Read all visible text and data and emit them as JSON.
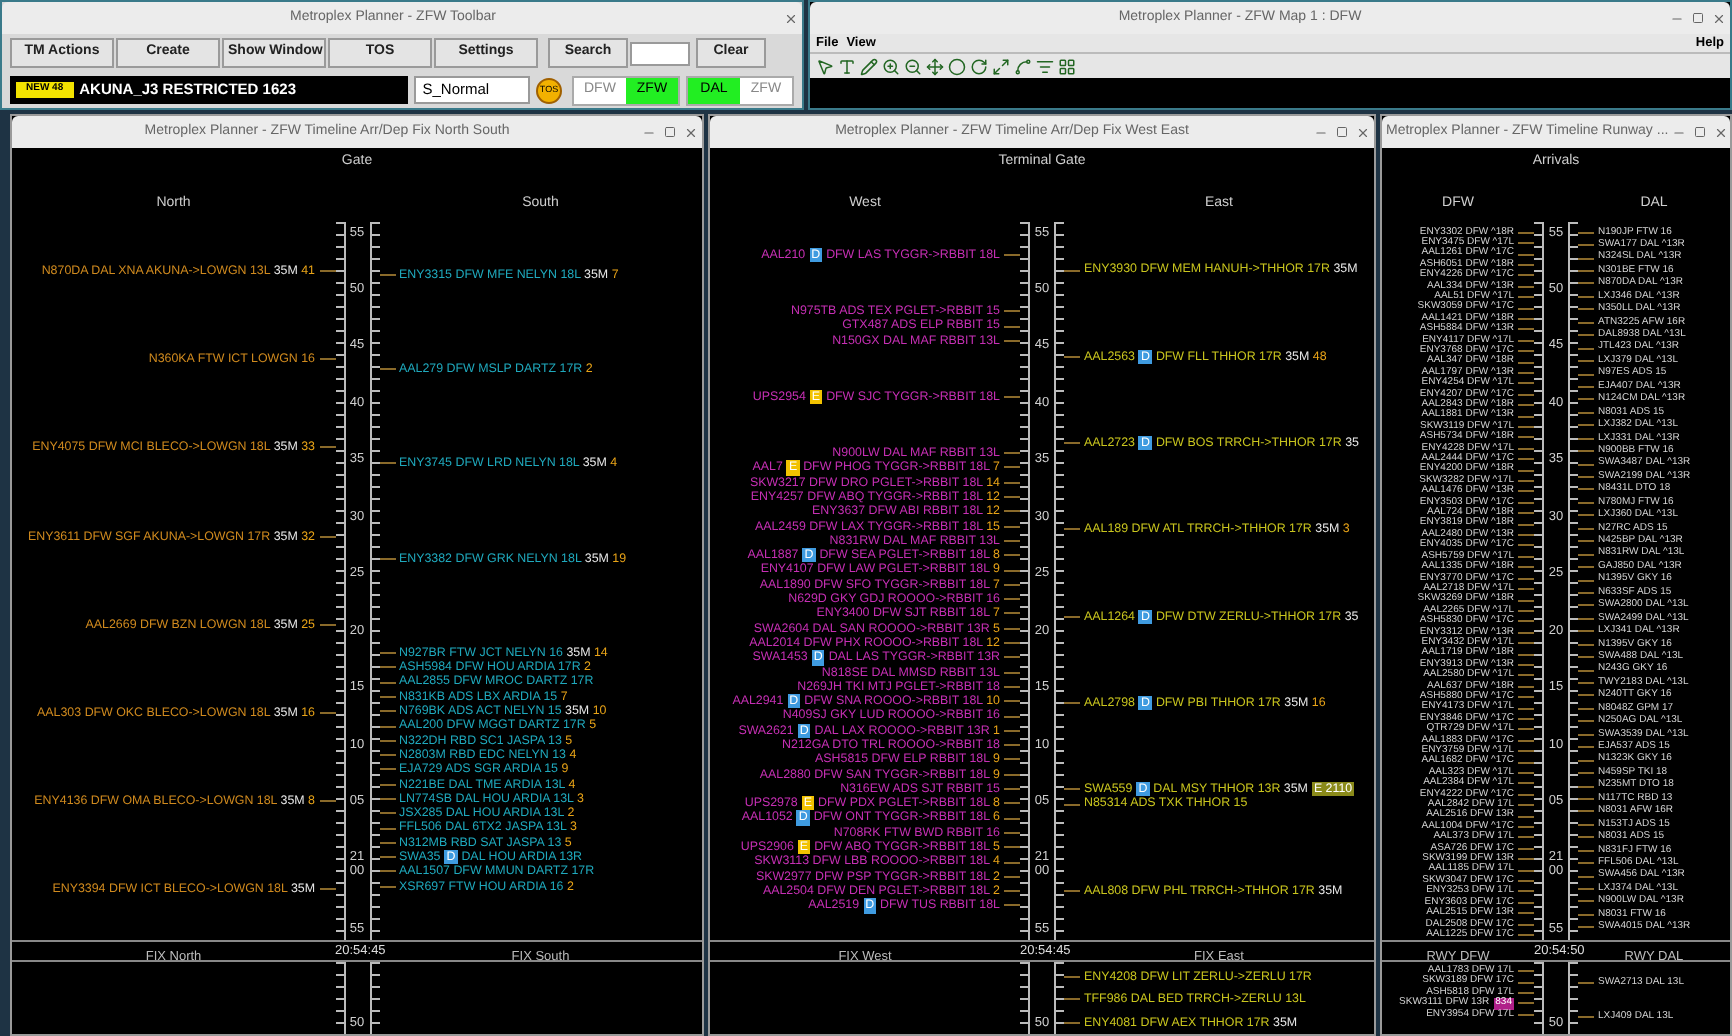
{
  "toolbar": {
    "title": "Metroplex Planner - ZFW Toolbar",
    "buttons": [
      "TM Actions",
      "Create",
      "Show Window",
      "TOS",
      "Settings"
    ],
    "search_button": "Search",
    "clear_button": "Clear",
    "alert_badge": "NEW 48",
    "message": "AKUNA_J3 RESTRICTED 1623",
    "mode_field": "S_Normal",
    "tos_indicator": "TOS",
    "toggles": [
      {
        "label": "DFW",
        "selected": false
      },
      {
        "label": "ZFW",
        "selected": true
      },
      {
        "label": "DAL",
        "selected": true
      },
      {
        "label": "ZFW",
        "selected": false
      }
    ]
  },
  "map_window": {
    "title": "Metroplex Planner - ZFW Map 1 : DFW",
    "menu": [
      "File",
      "View"
    ],
    "help_menu": "Help"
  },
  "timelines": [
    {
      "kind": "fix",
      "title": "Metroplex Planner - ZFW Timeline Arr/Dep Fix North South",
      "heading": "Gate",
      "scale_labels": [
        "55",
        "50",
        "45",
        "40",
        "35",
        "30",
        "25",
        "20",
        "15",
        "10",
        "05",
        "21 00",
        "55"
      ],
      "footer_time": "20:54:45",
      "lower_scale_label": "50",
      "columns": [
        {
          "heading": "North",
          "footer": "FIX North",
          "color": "#d08a1e",
          "groups": [
            [
              {
                "callsign": "N870DA",
                "route": "DAL XNA AKUNA->LOWGN 13L",
                "size": "35M",
                "count": "41"
              }
            ],
            [
              {
                "callsign": "N360KA",
                "route": "FTW ICT LOWGN 16"
              }
            ],
            [
              {
                "callsign": "ENY4075",
                "route": "DFW MCI BLECO->LOWGN 18L",
                "size": "35M",
                "count": "33"
              }
            ],
            [
              {
                "callsign": "ENY3611",
                "route": "DFW SGF AKUNA->LOWGN 17R",
                "size": "35M",
                "count": "32"
              }
            ],
            [
              {
                "callsign": "AAL2669",
                "route": "DFW BZN LOWGN 18L",
                "size": "35M",
                "count": "25"
              }
            ],
            [
              {
                "callsign": "AAL303",
                "route": "DFW OKC BLECO->LOWGN 18L",
                "size": "35M",
                "count": "16"
              }
            ],
            [
              {
                "callsign": "ENY4136",
                "route": "DFW OMA BLECO->LOWGN 18L",
                "size": "35M",
                "count": "8"
              }
            ],
            [
              {
                "callsign": "ENY3394",
                "route": "DFW ICT BLECO->LOWGN 18L",
                "size": "35M"
              }
            ]
          ]
        },
        {
          "heading": "South",
          "footer": "FIX South",
          "color": "#1fa9bd",
          "groups": [
            [
              {
                "callsign": "ENY3315",
                "route": "DFW MFE NELYN 18L",
                "size": "35M",
                "count": "7"
              }
            ],
            [
              {
                "callsign": "AAL279",
                "route": "DFW MSLP DARTZ 17R",
                "count": "2"
              }
            ],
            [
              {
                "callsign": "ENY3745",
                "route": "DFW LRD NELYN 18L",
                "size": "35M",
                "count": "4"
              }
            ],
            [
              {
                "callsign": "ENY3382",
                "route": "DFW GRK NELYN 18L",
                "size": "35M",
                "count": "19"
              }
            ],
            [
              {
                "callsign": "N927BR",
                "route": "FTW JCT NELYN 16",
                "size": "35M",
                "count": "14"
              },
              {
                "callsign": "ASH5984",
                "route": "DFW HOU ARDIA 17R",
                "count": "2"
              },
              {
                "callsign": "AAL2855",
                "route": "DFW MROC DARTZ 17R"
              },
              {
                "callsign": "N831KB",
                "route": "ADS LBX ARDIA 15",
                "count": "7"
              },
              {
                "callsign": "N769BK",
                "route": "ADS ACT NELYN 15",
                "size": "35M",
                "count": "10"
              },
              {
                "callsign": "AAL200",
                "route": "DFW MGGT DARTZ 17R",
                "count": "5"
              },
              {
                "callsign": "N322DH",
                "route": "RBD SC1 JASPA 13",
                "count": "5"
              },
              {
                "callsign": "N2803M",
                "route": "RBD EDC NELYN 13",
                "count": "4"
              },
              {
                "callsign": "EJA729",
                "route": "ADS SGR ARDIA 15",
                "count": "9"
              },
              {
                "callsign": "N221BE",
                "route": "DAL TME ARDIA 13L",
                "count": "4"
              },
              {
                "callsign": "LN774SB",
                "route": "DAL HOU ARDIA 13L",
                "count": "3"
              },
              {
                "callsign": "JSX285",
                "route": "DAL HOU ARDIA 13L",
                "count": "2"
              },
              {
                "callsign": "FFL506",
                "route": "DAL 6TX2 JASPA 13L",
                "count": "3"
              },
              {
                "callsign": "N312MB",
                "route": "RBD SAT JASPA 13",
                "count": "5"
              },
              {
                "callsign": "SWA35",
                "badge": {
                  "label": "D",
                  "color": "#3f9be0"
                },
                "route": "DAL HOU ARDIA 13R"
              },
              {
                "callsign": "AAL1507",
                "route": "DFW MMUN DARTZ 17R"
              },
              {
                "callsign": "XSR697",
                "route": "FTW HOU ARDIA 16",
                "count": "2"
              }
            ]
          ]
        }
      ]
    },
    {
      "kind": "fix",
      "title": "Metroplex Planner - ZFW Timeline Arr/Dep Fix West East",
      "heading": "Terminal Gate",
      "scale_labels": [
        "55",
        "50",
        "45",
        "40",
        "35",
        "30",
        "25",
        "20",
        "15",
        "10",
        "05",
        "21 00",
        "55"
      ],
      "footer_time": "20:54:45",
      "lower_scale_label": "50",
      "columns": [
        {
          "heading": "West",
          "footer": "FIX West",
          "color": "#c62fb4",
          "groups": [
            [
              {
                "callsign": "AAL210",
                "badge": {
                  "label": "D",
                  "color": "#3f9be0"
                },
                "route": "DFW LAS TYGGR->RBBIT 18L"
              }
            ],
            [
              {
                "callsign": "N975TB",
                "route": "ADS TEX PGLET->RBBIT 15"
              },
              {
                "callsign": "GTX487",
                "route": "ADS ELP RBBIT 15"
              },
              {
                "callsign": "N150GX",
                "route": "DAL MAF RBBIT 13L"
              }
            ],
            [
              {
                "callsign": "UPS2954",
                "badge": {
                  "label": "E",
                  "color": "#f2c200"
                },
                "route": "DFW SJC TYGGR->RBBIT 18L"
              }
            ],
            [
              {
                "callsign": "N900LW",
                "route": "DAL MAF RBBIT 13L"
              },
              {
                "callsign": "AAL7",
                "badge": {
                  "label": "E",
                  "color": "#f2c200"
                },
                "route": "DFW PHOG TYGGR->RBBIT 18L",
                "count": "7"
              },
              {
                "callsign": "SKW3217",
                "route": "DFW DRO PGLET->RBBIT 18L",
                "count": "14"
              },
              {
                "callsign": "ENY4257",
                "route": "DFW ABQ TYGGR->RBBIT 18L",
                "count": "12"
              },
              {
                "callsign": "ENY3637",
                "route": "DFW ABI RBBIT 18L",
                "count": "12"
              },
              {
                "callsign": "AAL2459",
                "route": "DFW LAX TYGGR->RBBIT 18L",
                "count": "15"
              },
              {
                "callsign": "N831RW",
                "route": "DAL MAF RBBIT 13L"
              },
              {
                "callsign": "AAL1887",
                "badge": {
                  "label": "D",
                  "color": "#3f9be0"
                },
                "route": "DFW SEA PGLET->RBBIT 18L",
                "count": "8"
              },
              {
                "callsign": "ENY4107",
                "route": "DFW LAW PGLET->RBBIT 18L",
                "count": "9"
              },
              {
                "callsign": "AAL1890",
                "route": "DFW SFO TYGGR->RBBIT 18L",
                "count": "7"
              },
              {
                "callsign": "N629D",
                "route": "GKY GDJ ROOOO->RBBIT 16"
              },
              {
                "callsign": "ENY3400",
                "route": "DFW SJT RBBIT 18L",
                "count": "7"
              },
              {
                "callsign": "SWA2604",
                "route": "DAL SAN ROOOO->RBBIT 13R",
                "count": "5"
              },
              {
                "callsign": "AAL2014",
                "route": "DFW PHX ROOOO->RBBIT 18L",
                "count": "12"
              },
              {
                "callsign": "SWA1453",
                "badge": {
                  "label": "D",
                  "color": "#3f9be0"
                },
                "route": "DAL LAS TYGGR->RBBIT 13R"
              },
              {
                "callsign": "N818SE",
                "route": "DAL MMSD RBBIT 13L"
              },
              {
                "callsign": "N269JH",
                "route": "TKI MTJ PGLET->RBBIT 18"
              },
              {
                "callsign": "AAL2941",
                "badge": {
                  "label": "D",
                  "color": "#3f9be0"
                },
                "route": "DFW SNA ROOOO->RBBIT 18L",
                "count": "10"
              },
              {
                "callsign": "N409SJ",
                "route": "GKY LUD ROOOO->RBBIT 16"
              },
              {
                "callsign": "SWA2621",
                "badge": {
                  "label": "D",
                  "color": "#3f9be0"
                },
                "route": "DAL LAX ROOOO->RBBIT 13R",
                "count": "1"
              },
              {
                "callsign": "N212GA",
                "route": "DTO TRL ROOOO->RBBIT 18"
              },
              {
                "callsign": "ASH5815",
                "route": "DFW ELP RBBIT 18L",
                "count": "9"
              },
              {
                "callsign": "AAL2880",
                "route": "DFW SAN TYGGR->RBBIT 18L",
                "count": "9"
              },
              {
                "callsign": "N316EW",
                "route": "ADS SJT RBBIT 15"
              },
              {
                "callsign": "UPS2978",
                "badge": {
                  "label": "E",
                  "color": "#f2c200"
                },
                "route": "DFW PDX PGLET->RBBIT 18L",
                "count": "8"
              },
              {
                "callsign": "AAL1052",
                "badge": {
                  "label": "D",
                  "color": "#3f9be0"
                },
                "route": "DFW ONT TYGGR->RBBIT 18L",
                "count": "6"
              },
              {
                "callsign": "N708RK",
                "route": "FTW BWD RBBIT 16"
              },
              {
                "callsign": "UPS2906",
                "badge": {
                  "label": "E",
                  "color": "#f2c200"
                },
                "route": "DFW ABQ TYGGR->RBBIT 18L",
                "count": "5"
              },
              {
                "callsign": "SKW3113",
                "route": "DFW LBB ROOOO->RBBIT 18L",
                "count": "4"
              },
              {
                "callsign": "SKW2977",
                "route": "DFW PSP TYGGR->RBBIT 18L",
                "count": "2"
              },
              {
                "callsign": "AAL2504",
                "route": "DFW DEN PGLET->RBBIT 18L",
                "count": "2"
              },
              {
                "callsign": "AAL2519",
                "badge": {
                  "label": "D",
                  "color": "#3f9be0"
                },
                "route": "DFW TUS RBBIT 18L"
              }
            ]
          ]
        },
        {
          "heading": "East",
          "footer": "FIX East",
          "color": "#c9c51e",
          "groups": [
            [
              {
                "callsign": "ENY3930",
                "route": "DFW MEM HANUH->THHOR 17R",
                "size": "35M"
              }
            ],
            [
              {
                "callsign": "AAL2563",
                "badge": {
                  "label": "D",
                  "color": "#3f9be0"
                },
                "route": "DFW FLL THHOR 17R",
                "size": "35M",
                "count": "48"
              }
            ],
            [
              {
                "callsign": "AAL2723",
                "badge": {
                  "label": "D",
                  "color": "#3f9be0"
                },
                "route": "DFW BOS TRRCH->THHOR 17R",
                "size": "35"
              }
            ],
            [
              {
                "callsign": "AAL189",
                "route": "DFW ATL TRRCH->THHOR 17R",
                "size": "35M",
                "count": "3"
              }
            ],
            [
              {
                "callsign": "AAL1264",
                "badge": {
                  "label": "D",
                  "color": "#3f9be0"
                },
                "route": "DFW DTW ZERLU->THHOR 17R",
                "size": "35"
              }
            ],
            [
              {
                "callsign": "AAL2798",
                "badge": {
                  "label": "D",
                  "color": "#3f9be0"
                },
                "route": "DFW PBI THHOR 17R",
                "size": "35M",
                "count": "16"
              }
            ],
            [
              {
                "callsign": "SWA559",
                "badge": {
                  "label": "D",
                  "color": "#3f9be0"
                },
                "route": "DAL MSY THHOR 13R",
                "size": "35M",
                "tag": {
                  "label": "E 2110",
                  "color": "#8a8a1a"
                }
              },
              {
                "callsign": "N85314",
                "route": "ADS TXK THHOR 15"
              }
            ],
            [
              {
                "callsign": "AAL808",
                "route": "DFW PHL TRRCH->THHOR 17R",
                "size": "35M"
              }
            ]
          ],
          "lower": [
            {
              "callsign": "ENY4208",
              "route": "DFW LIT ZERLU->ZERLU 17R"
            },
            {
              "callsign": "TFF986",
              "route": "DAL BED TRRCH->ZERLU 13L"
            },
            {
              "callsign": "ENY4081",
              "route": "DFW AEX THHOR 17R",
              "size": "35M"
            }
          ]
        }
      ]
    },
    {
      "kind": "runway",
      "title": "Metroplex Planner - ZFW Timeline Runway ...",
      "heading": "Arrivals",
      "scale_labels": [
        "55",
        "50",
        "45",
        "40",
        "35",
        "30",
        "25",
        "20",
        "15",
        "10",
        "05",
        "21 00",
        "55"
      ],
      "footer_time": "20:54:50",
      "lower_scale_label": "50",
      "columns": [
        {
          "heading": "DFW",
          "footer": "RWY DFW",
          "groups": [
            [
              {
                "callsign": "ENY3302",
                "route": "DFW ^18R"
              },
              {
                "callsign": "ENY3475",
                "route": "DFW ^17L"
              },
              {
                "callsign": "AAL1261",
                "route": "DFW ^17C"
              },
              {
                "callsign": "ASH6051",
                "route": "DFW ^18R"
              },
              {
                "callsign": "ENY4226",
                "route": "DFW ^17C"
              },
              {
                "callsign": "AAL334",
                "route": "DFW ^13R"
              },
              {
                "callsign": "AAL51",
                "route": "DFW ^17L"
              },
              {
                "callsign": "SKW3059",
                "route": "DFW ^17C"
              },
              {
                "callsign": "AAL1421",
                "route": "DFW ^18R"
              },
              {
                "callsign": "ASH5884",
                "route": "DFW ^13R"
              },
              {
                "callsign": "ENY4117",
                "route": "DFW ^17L"
              },
              {
                "callsign": "ENY3768",
                "route": "DFW ^17C"
              },
              {
                "callsign": "AAL347",
                "route": "DFW ^18R"
              },
              {
                "callsign": "AAL1797",
                "route": "DFW ^13R"
              },
              {
                "callsign": "ENY4254",
                "route": "DFW ^17L"
              },
              {
                "callsign": "ENY4207",
                "route": "DFW ^17C"
              },
              {
                "callsign": "AAL2843",
                "route": "DFW ^18R"
              },
              {
                "callsign": "AAL1881",
                "route": "DFW ^13R"
              },
              {
                "callsign": "SKW3119",
                "route": "DFW ^17L"
              },
              {
                "callsign": "ASH5734",
                "route": "DFW ^18R"
              },
              {
                "callsign": "ENY4228",
                "route": "DFW ^17L"
              },
              {
                "callsign": "AAL2444",
                "route": "DFW ^17C"
              },
              {
                "callsign": "ENY4200",
                "route": "DFW ^18R"
              },
              {
                "callsign": "SKW3282",
                "route": "DFW ^17L"
              },
              {
                "callsign": "AAL1476",
                "route": "DFW ^13R"
              },
              {
                "callsign": "ENY3503",
                "route": "DFW ^17C"
              },
              {
                "callsign": "AAL724",
                "route": "DFW ^18R"
              },
              {
                "callsign": "ENY3819",
                "route": "DFW ^18R"
              },
              {
                "callsign": "AAL2480",
                "route": "DFW ^13R"
              },
              {
                "callsign": "ENY4035",
                "route": "DFW ^17C"
              },
              {
                "callsign": "ASH5759",
                "route": "DFW ^17L"
              },
              {
                "callsign": "AAL1335",
                "route": "DFW ^18R"
              },
              {
                "callsign": "ENY3770",
                "route": "DFW ^17C"
              },
              {
                "callsign": "AAL2718",
                "route": "DFW ^17L"
              },
              {
                "callsign": "SKW3269",
                "route": "DFW ^18R"
              },
              {
                "callsign": "AAL2265",
                "route": "DFW ^17L"
              },
              {
                "callsign": "ASH5830",
                "route": "DFW ^17C"
              },
              {
                "callsign": "ENY3312",
                "route": "DFW ^13R"
              },
              {
                "callsign": "ENY3432",
                "route": "DFW ^17L"
              },
              {
                "callsign": "AAL1719",
                "route": "DFW ^18R"
              },
              {
                "callsign": "ENY3913",
                "route": "DFW ^13R"
              },
              {
                "callsign": "AAL2580",
                "route": "DFW ^17L"
              },
              {
                "callsign": "AAL637",
                "route": "DFW ^18R"
              },
              {
                "callsign": "ASH5880",
                "route": "DFW ^17C"
              },
              {
                "callsign": "ENY4173",
                "route": "DFW ^17L"
              },
              {
                "callsign": "ENY3846",
                "route": "DFW ^17C"
              },
              {
                "callsign": "QTR729",
                "route": "DFW ^17L"
              },
              {
                "callsign": "AAL1883",
                "route": "DFW ^17C"
              },
              {
                "callsign": "ENY3759",
                "route": "DFW ^17L"
              },
              {
                "callsign": "AAL1682",
                "route": "DFW ^17C"
              },
              {
                "callsign": "AAL323",
                "route": "DFW ^17L"
              },
              {
                "callsign": "AAL2384",
                "route": "DFW ^17L"
              },
              {
                "callsign": "ENY4222",
                "route": "DFW ^17C"
              },
              {
                "callsign": "AAL2842",
                "route": "DFW 17L"
              },
              {
                "callsign": "AAL2516",
                "route": "DFW 13R"
              },
              {
                "callsign": "AAL1004",
                "route": "DFW ^17C"
              },
              {
                "callsign": "AAL373",
                "route": "DFW 17L"
              },
              {
                "callsign": "ASA726",
                "route": "DFW 17C"
              },
              {
                "callsign": "SKW3199",
                "route": "DFW 13R"
              },
              {
                "callsign": "AAL1185",
                "route": "DFW 17L"
              },
              {
                "callsign": "SKW3047",
                "route": "DFW 17C"
              },
              {
                "callsign": "ENY3253",
                "route": "DFW 17L"
              },
              {
                "callsign": "ENY3603",
                "route": "DFW 17C"
              },
              {
                "callsign": "AAL2515",
                "route": "DFW 13R"
              },
              {
                "callsign": "DAL2508",
                "route": "DFW 17C"
              },
              {
                "callsign": "AAL1225",
                "route": "DFW 17C"
              }
            ]
          ],
          "lower": [
            {
              "callsign": "AAL1783",
              "route": "DFW 17L"
            },
            {
              "callsign": "SKW3189",
              "route": "DFW 17C"
            },
            {
              "callsign": "ASH5818",
              "route": "DFW 17L"
            },
            {
              "callsign": "SKW3111",
              "route": "DFW 13R",
              "tag": {
                "label": "834",
                "color": "#b0208a"
              }
            },
            {
              "callsign": "ENY3954",
              "route": "DFW 17L"
            }
          ]
        },
        {
          "heading": "DAL",
          "footer": "RWY DAL",
          "groups": [
            [
              {
                "callsign": "N190JP",
                "route": "FTW 16"
              },
              {
                "callsign": "SWA177",
                "route": "DAL ^13R"
              },
              {
                "callsign": "N324SL",
                "route": "DAL ^13R"
              },
              {
                "callsign": "N301BE",
                "route": "FTW 16"
              },
              {
                "callsign": "N870DA",
                "route": "DAL ^13R"
              },
              {
                "callsign": "LXJ346",
                "route": "DAL ^13R"
              },
              {
                "callsign": "N350LL",
                "route": "DAL ^13R"
              },
              {
                "callsign": "ATN3225",
                "route": "AFW 16R"
              },
              {
                "callsign": "DAL8938",
                "route": "DAL ^13L"
              },
              {
                "callsign": "JTL423",
                "route": "DAL ^13R"
              },
              {
                "callsign": "LXJ379",
                "route": "DAL ^13L"
              },
              {
                "callsign": "N97ES",
                "route": "ADS 15"
              },
              {
                "callsign": "EJA407",
                "route": "DAL ^13R"
              },
              {
                "callsign": "N124CM",
                "route": "DAL ^13R"
              },
              {
                "callsign": "N8031",
                "route": "ADS 15"
              },
              {
                "callsign": "LXJ382",
                "route": "DAL ^13L"
              },
              {
                "callsign": "LXJ331",
                "route": "DAL ^13R"
              },
              {
                "callsign": "N900BB",
                "route": "FTW 16"
              },
              {
                "callsign": "SWA3487",
                "route": "DAL ^13R"
              },
              {
                "callsign": "SWA2199",
                "route": "DAL ^13R"
              },
              {
                "callsign": "N8431L",
                "route": "DTO 18"
              },
              {
                "callsign": "N780MJ",
                "route": "FTW 16"
              },
              {
                "callsign": "LXJ360",
                "route": "DAL ^13L"
              },
              {
                "callsign": "N27RC",
                "route": "ADS 15"
              },
              {
                "callsign": "N425BP",
                "route": "DAL ^13R"
              },
              {
                "callsign": "N831RW",
                "route": "DAL ^13L"
              },
              {
                "callsign": "GAJ850",
                "route": "DAL ^13R"
              },
              {
                "callsign": "N1395V",
                "route": "GKY 16"
              },
              {
                "callsign": "N633SF",
                "route": "ADS 15"
              },
              {
                "callsign": "SWA2800",
                "route": "DAL ^13L"
              },
              {
                "callsign": "SWA2499",
                "route": "DAL ^13L"
              },
              {
                "callsign": "LXJ341",
                "route": "DAL ^13R"
              },
              {
                "callsign": "N1395V",
                "route": "GKY 16"
              },
              {
                "callsign": "SWA488",
                "route": "DAL ^13L"
              },
              {
                "callsign": "N243G",
                "route": "GKY 16"
              },
              {
                "callsign": "TWY2183",
                "route": "DAL ^13L"
              },
              {
                "callsign": "N240TT",
                "route": "GKY 16"
              },
              {
                "callsign": "N8048Z",
                "route": "GPM 17"
              },
              {
                "callsign": "N250AG",
                "route": "DAL ^13L"
              },
              {
                "callsign": "SWA3539",
                "route": "DAL ^13L"
              },
              {
                "callsign": "EJA537",
                "route": "ADS 15"
              },
              {
                "callsign": "N1323K",
                "route": "GKY 16"
              },
              {
                "callsign": "N459SP",
                "route": "TKI 18"
              },
              {
                "callsign": "N235MT",
                "route": "DTO 18"
              },
              {
                "callsign": "N117TC",
                "route": "RBD 13"
              },
              {
                "callsign": "N8031",
                "route": "AFW 16R"
              },
              {
                "callsign": "N153TJ",
                "route": "ADS 15"
              },
              {
                "callsign": "N8031",
                "route": "ADS 15"
              },
              {
                "callsign": "N831FJ",
                "route": "FTW 16"
              },
              {
                "callsign": "FFL506",
                "route": "DAL ^13L"
              },
              {
                "callsign": "SWA456",
                "route": "DAL ^13R"
              },
              {
                "callsign": "LXJ374",
                "route": "DAL ^13L"
              },
              {
                "callsign": "N900LW",
                "route": "DAL ^13R"
              },
              {
                "callsign": "N8031",
                "route": "FTW 16"
              },
              {
                "callsign": "SWA4015",
                "route": "DAL ^13R"
              }
            ]
          ],
          "lower": [
            {
              "callsign": "SWA2713",
              "route": "DAL 13L"
            },
            {
              "callsign": "LXJ409",
              "route": "DAL 13L"
            }
          ]
        }
      ]
    }
  ]
}
